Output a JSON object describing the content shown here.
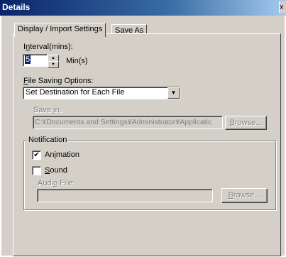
{
  "window": {
    "title": "Details",
    "close_glyph": "x"
  },
  "tabs": [
    {
      "label": "Display / Import Settings",
      "active": true
    },
    {
      "label": "Save As",
      "active": false
    }
  ],
  "interval": {
    "label_prefix": "I",
    "label_accel": "n",
    "label_rest": "terval(mins):",
    "value": "5",
    "unit": "Min(s)"
  },
  "file_saving": {
    "label_accel": "F",
    "label_rest": "ile Saving Options:",
    "selected": "Set Destination for Each File"
  },
  "save_in": {
    "label_prefix": "Save ",
    "label_accel": "i",
    "label_rest": "n:",
    "value": "C:¥Documents and Settings¥Administrator¥Applicatic",
    "browse_label": "Browse...",
    "browse_accel": "B"
  },
  "notification": {
    "group_label": "Notification",
    "animation": {
      "label_prefix": "An",
      "label_accel": "i",
      "label_rest": "mation",
      "checked": true
    },
    "sound": {
      "label_accel": "S",
      "label_rest": "ound",
      "checked": false
    },
    "audio_file": {
      "label_prefix": "Audi",
      "label_accel": "o",
      "label_rest": " File:",
      "value": "",
      "browse_label": "Browse..."
    }
  },
  "icons": {
    "spin_up": "arrow-up-icon",
    "spin_down": "arrow-down-icon",
    "dropdown": "chevron-down-icon",
    "check": "checkmark-icon"
  },
  "colors": {
    "titlebar_start": "#0a246a",
    "titlebar_end": "#a6caf0",
    "face": "#d4d0c8"
  }
}
